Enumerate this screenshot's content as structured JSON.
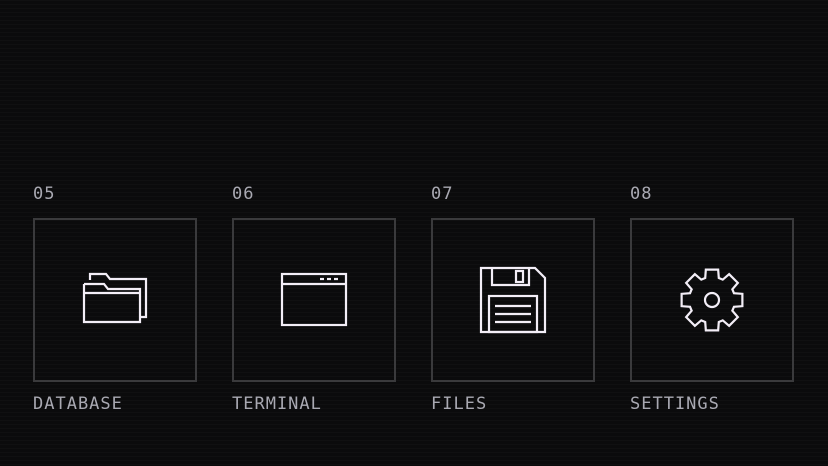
{
  "colors": {
    "background": "#0b0b0c",
    "tile_border": "#3a3a3c",
    "icon_stroke": "#f3eef7",
    "text": "#a9a9b2"
  },
  "tiles": [
    {
      "number": "05",
      "label": "DATABASE",
      "icon": "folder-icon"
    },
    {
      "number": "06",
      "label": "TERMINAL",
      "icon": "window-icon"
    },
    {
      "number": "07",
      "label": "FILES",
      "icon": "floppy-disk-icon"
    },
    {
      "number": "08",
      "label": "SETTINGS",
      "icon": "gear-icon"
    }
  ]
}
